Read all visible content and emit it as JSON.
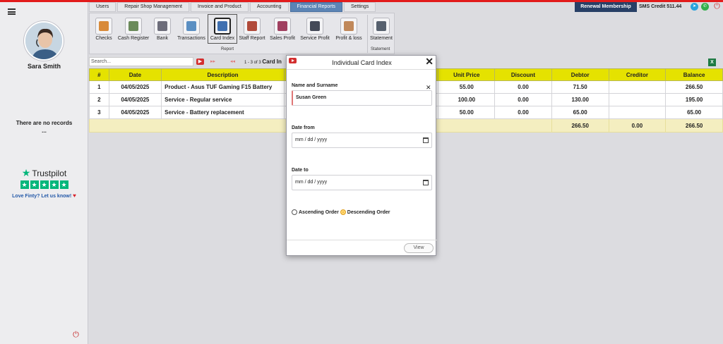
{
  "user": {
    "name": "Sara Smith"
  },
  "sidebar": {
    "no_records": "There are no records",
    "ellipsis": "...",
    "trustpilot": "Trustpilot",
    "stars": [
      "★",
      "★",
      "★",
      "★",
      "★"
    ],
    "love_text": "Love Finty? Let us know!"
  },
  "nav": {
    "tabs": [
      "Users",
      "Repair Shop Management",
      "Invoice and Product",
      "Accounting",
      "Financial Reports",
      "Settings"
    ],
    "active_tab": "Financial Reports",
    "renewal": "Renewal Membership",
    "sms_credit": "SMS Credit 511.44"
  },
  "toolbar": {
    "items": [
      {
        "label": "Checks",
        "icon": "checks-icon",
        "color": "#d88a3a"
      },
      {
        "label": "Cash Register",
        "icon": "cash-register-icon",
        "color": "#6a8a5a"
      },
      {
        "label": "Bank",
        "icon": "bank-icon",
        "color": "#6d6d7a"
      },
      {
        "label": "Transactions",
        "icon": "transactions-icon",
        "color": "#5b8fc2"
      },
      {
        "label": "Card Index",
        "icon": "card-index-icon",
        "color": "#3f6fb0"
      },
      {
        "label": "Staff Report",
        "icon": "staff-report-icon",
        "color": "#b04a3a"
      },
      {
        "label": "Sales Profit",
        "icon": "sales-profit-icon",
        "color": "#a04060"
      },
      {
        "label": "Service Profit",
        "icon": "service-profit-icon",
        "color": "#444a58"
      },
      {
        "label": "Profit & loss",
        "icon": "profit-loss-icon",
        "color": "#c0885a"
      },
      {
        "label": "Statement",
        "icon": "statement-icon",
        "color": "#56606e"
      }
    ],
    "group_report": "Report",
    "group_statement": "Statement"
  },
  "search": {
    "placeholder": "Search...",
    "page_info": "1 - 3 of 3",
    "page_title": "Card In"
  },
  "table": {
    "columns": [
      "#",
      "Date",
      "Description",
      "Unit Price",
      "Discount",
      "Debtor",
      "Creditor",
      "Balance"
    ],
    "rows": [
      {
        "n": "1",
        "date": "04/05/2025",
        "desc": "Product - Asus TUF Gaming F15 Battery",
        "price": "55.00",
        "disc": "0.00",
        "debtor": "71.50",
        "creditor": "",
        "balance": "266.50"
      },
      {
        "n": "2",
        "date": "04/05/2025",
        "desc": "Service - Regular service",
        "price": "100.00",
        "disc": "0.00",
        "debtor": "130.00",
        "creditor": "",
        "balance": "195.00"
      },
      {
        "n": "3",
        "date": "04/05/2025",
        "desc": "Service - Battery replacement",
        "price": "50.00",
        "disc": "0.00",
        "debtor": "65.00",
        "creditor": "",
        "balance": "65.00"
      }
    ],
    "totals": {
      "debtor": "266.50",
      "creditor": "0.00",
      "balance": "266.50"
    }
  },
  "modal": {
    "title": "Individual Card Index",
    "name_label": "Name and Surname",
    "name_value": "Susan Green",
    "date_from_label": "Date from",
    "date_from_value": "mm / dd / yyyy",
    "date_to_label": "Date to",
    "date_to_value": "mm / dd / yyyy",
    "ascending": "Ascending Order",
    "descending": "Descending Order",
    "selected_order": "Descending Order",
    "view_button": "View"
  },
  "colors": {
    "accent_red": "#e21b1b",
    "header_yellow": "#e5e200",
    "nav_active": "#5b84b5",
    "renewal_bg": "#273f66",
    "trust_green": "#00b67a"
  }
}
